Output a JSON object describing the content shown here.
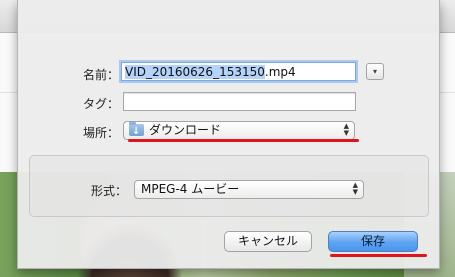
{
  "dialog": {
    "name_label": "名前：",
    "name_value_selected": "VID_20160626_153150",
    "name_value_ext": ".mp4",
    "expand_glyph": "▾",
    "tags_label": "タグ：",
    "tags_value": "",
    "where_label": "場所：",
    "where_value": "ダウンロード",
    "where_icon": "downloads-folder-icon",
    "format_label": "形式：",
    "format_value": "MPEG-4 ムービー",
    "cancel_label": "キャンセル",
    "save_label": "保存",
    "updown_glyph": "▲▼"
  },
  "colors": {
    "annotation_red": "#e2141b",
    "save_button_blue": "#5da3f1",
    "selection_highlight": "#b3d3fb"
  }
}
